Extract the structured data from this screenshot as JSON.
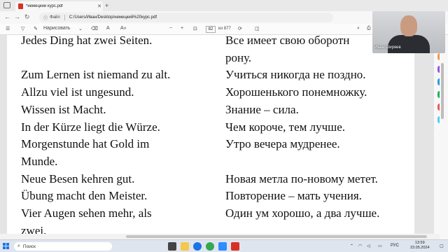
{
  "browser": {
    "tab_title": "*немецкий курс.pdf",
    "file_label": "Файл",
    "address": "C:/Users/Иван/Desktop/немецкий%20курс.pdf"
  },
  "pdf_toolbar": {
    "draw_label": "Нарисовать",
    "page_current": "82",
    "page_total": "из 877"
  },
  "document": {
    "lines": [
      {
        "de": "Jedes Ding hat zwei Seiten.",
        "ru": "Все имеет свою оборотн"
      },
      {
        "de": "",
        "ru": "рону."
      },
      {
        "de": "Zum Lernen ist niemand zu alt.",
        "ru": "Учиться никогда не поздно."
      },
      {
        "de": "Allzu viel ist ungesund.",
        "ru": "Хорошенького понемножку."
      },
      {
        "de": "Wissen ist Macht.",
        "ru": "Знание – сила."
      },
      {
        "de": "In der Kürze liegt die Würze.",
        "ru": "Чем короче, тем лучше."
      },
      {
        "de": "Morgenstunde hat Gold im",
        "ru": "Утро вечера мудренее."
      },
      {
        "de": "Munde.",
        "ru": ""
      },
      {
        "de": "Neue Besen kehren gut.",
        "ru": "Новая метла по-новому метет."
      },
      {
        "de": "Übung macht den Meister.",
        "ru": "Повторение – мать учения."
      },
      {
        "de": "Vier Augen sehen mehr, als",
        "ru": "Один ум хорошо, а два лучше."
      },
      {
        "de": "zwei.",
        "ru": ""
      }
    ]
  },
  "webcam": {
    "name": "Иван Ширяев"
  },
  "taskbar": {
    "search_placeholder": "Поиск",
    "lang": "РУС",
    "time": "13:59",
    "date": "23.05.2024"
  }
}
